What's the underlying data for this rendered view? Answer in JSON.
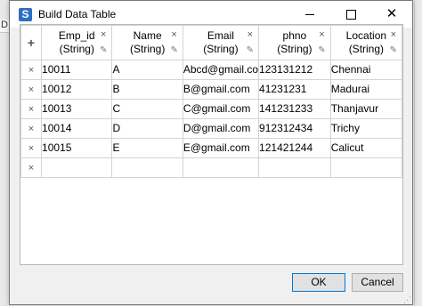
{
  "background": {
    "left_strip_text": "D"
  },
  "window": {
    "title": "Build Data Table",
    "app_icon": "S",
    "controls": {
      "minimize": "",
      "maximize": "",
      "close": "✕"
    }
  },
  "table": {
    "add_column_symbol": "+",
    "remove_row_symbol": "×",
    "remove_column_symbol": "×",
    "edit_column_symbol": "✎",
    "columns": [
      {
        "name": "Emp_id",
        "type": "(String)"
      },
      {
        "name": "Name",
        "type": "(String)"
      },
      {
        "name": "Email",
        "type": "(String)"
      },
      {
        "name": "phno",
        "type": "(String)"
      },
      {
        "name": "Location",
        "type": "(String)"
      }
    ],
    "rows": [
      [
        "10011",
        "A",
        "Abcd@gmail.co",
        "123131212",
        "Chennai"
      ],
      [
        "10012",
        "B",
        "B@gmail.com",
        "41231231",
        "Madurai"
      ],
      [
        "10013",
        "C",
        "C@gmail.com",
        "141231233",
        "Thanjavur"
      ],
      [
        "10014",
        "D",
        "D@gmail.com",
        "912312434",
        "Trichy"
      ],
      [
        "10015",
        "E",
        "E@gmail.com",
        "121421244",
        "Calicut"
      ],
      [
        "",
        "",
        "",
        "",
        ""
      ]
    ]
  },
  "buttons": {
    "ok": "OK",
    "cancel": "Cancel"
  }
}
